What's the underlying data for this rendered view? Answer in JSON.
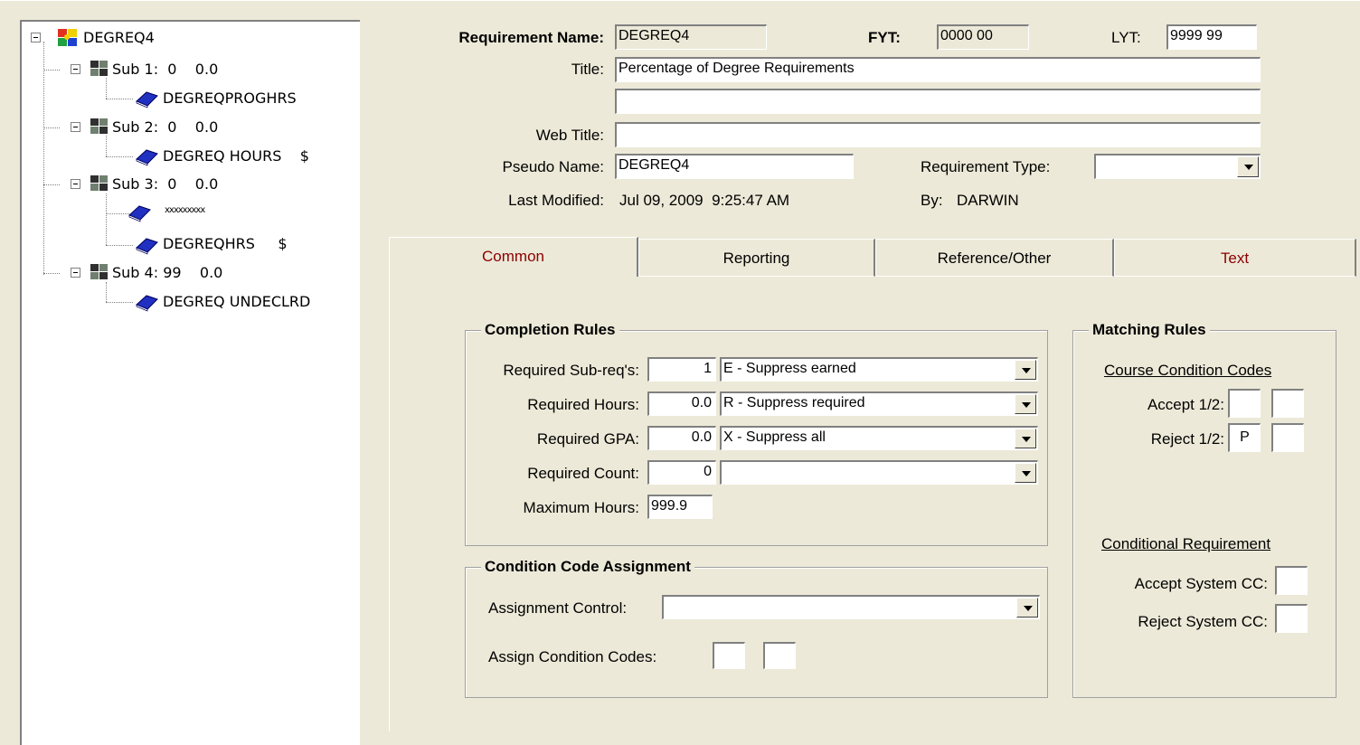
{
  "tree": {
    "root": "DEGREQ4",
    "subs": [
      {
        "label": "Sub 1:  0    0.0",
        "children": [
          "DEGREQPROGHRS"
        ]
      },
      {
        "label": "Sub 2:  0    0.0",
        "children": [
          "DEGREQ HOURS    $"
        ]
      },
      {
        "label": "Sub 3:  0    0.0",
        "children": [
          "xxxxxxxxx",
          "DEGREQHRS     $"
        ]
      },
      {
        "label": "Sub 4: 99    0.0",
        "children": [
          "DEGREQ UNDECLRD"
        ]
      }
    ]
  },
  "header": {
    "req_name_label": "Requirement Name:",
    "req_name": "DEGREQ4",
    "fyt_label": "FYT:",
    "fyt": "0000 00",
    "lyt_label": "LYT:",
    "lyt": "9999 99",
    "title_label": "Title:",
    "title1": "Percentage of Degree Requirements",
    "title2": "",
    "web_title_label": "Web Title:",
    "web_title": "",
    "pseudo_label": "Pseudo Name:",
    "pseudo": "DEGREQ4",
    "req_type_label": "Requirement Type:",
    "req_type": "",
    "modified_label": "Last Modified:",
    "modified": "Jul 09, 2009  9:25:47 AM",
    "by_label": "By:",
    "by": "DARWIN"
  },
  "tabs": [
    {
      "label": "Common",
      "color": "#8b0000"
    },
    {
      "label": "Reporting",
      "color": "#000000"
    },
    {
      "label": "Reference/Other",
      "color": "#000000"
    },
    {
      "label": "Text",
      "color": "#8b0000"
    }
  ],
  "completion": {
    "title": "Completion Rules",
    "rows": [
      {
        "label": "Required Sub-req's:",
        "value": "1",
        "option": "E - Suppress earned"
      },
      {
        "label": "Required Hours:",
        "value": "0.0",
        "option": "R - Suppress required"
      },
      {
        "label": "Required GPA:",
        "value": "0.0",
        "option": "X - Suppress all"
      },
      {
        "label": "Required Count:",
        "value": "0",
        "option": ""
      }
    ],
    "max_label": "Maximum Hours:",
    "max_value": "999.9"
  },
  "condition": {
    "title": "Condition Code Assignment",
    "control_label": "Assignment Control:",
    "control_value": "",
    "assign_label": "Assign Condition Codes:",
    "assign1": "",
    "assign2": ""
  },
  "matching": {
    "title": "Matching Rules",
    "ccc_heading": "Course Condition Codes",
    "accept_label": "Accept 1/2:",
    "accept1": "",
    "accept2": "",
    "reject_label": "Reject 1/2:",
    "reject1": "P",
    "reject2": "",
    "cond_heading": "Conditional Requirement",
    "accept_sys_label": "Accept System CC:",
    "accept_sys": "",
    "reject_sys_label": "Reject System CC:",
    "reject_sys": ""
  }
}
